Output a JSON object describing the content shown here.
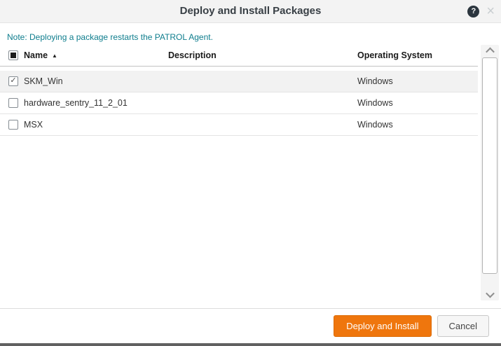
{
  "dialog": {
    "title": "Deploy and Install Packages",
    "note": "Note: Deploying a package restarts the PATROL Agent."
  },
  "icons": {
    "help": "?",
    "close": "×",
    "check": "✓",
    "sort_ascending": "▲"
  },
  "table": {
    "select_all_indeterminate": true,
    "sort": {
      "column": "Name",
      "direction": "ascending"
    },
    "columns": {
      "name": "Name",
      "description": "Description",
      "os": "Operating System"
    },
    "rows": [
      {
        "name": "SKM_Win",
        "description": "",
        "os": "Windows",
        "checked": true,
        "highlighted": true
      },
      {
        "name": "hardware_sentry_11_2_01",
        "description": "",
        "os": "Windows",
        "checked": false,
        "highlighted": false
      },
      {
        "name": "MSX",
        "description": "",
        "os": "Windows",
        "checked": false,
        "highlighted": false
      }
    ]
  },
  "footer": {
    "deploy_button": "Deploy and Install",
    "cancel_button": "Cancel"
  },
  "colors": {
    "accent_orange": "#ef760d",
    "note_teal": "#0e7d8d",
    "header_bg": "#f3f3f3",
    "selected_row_bg": "#f2f2f2"
  }
}
